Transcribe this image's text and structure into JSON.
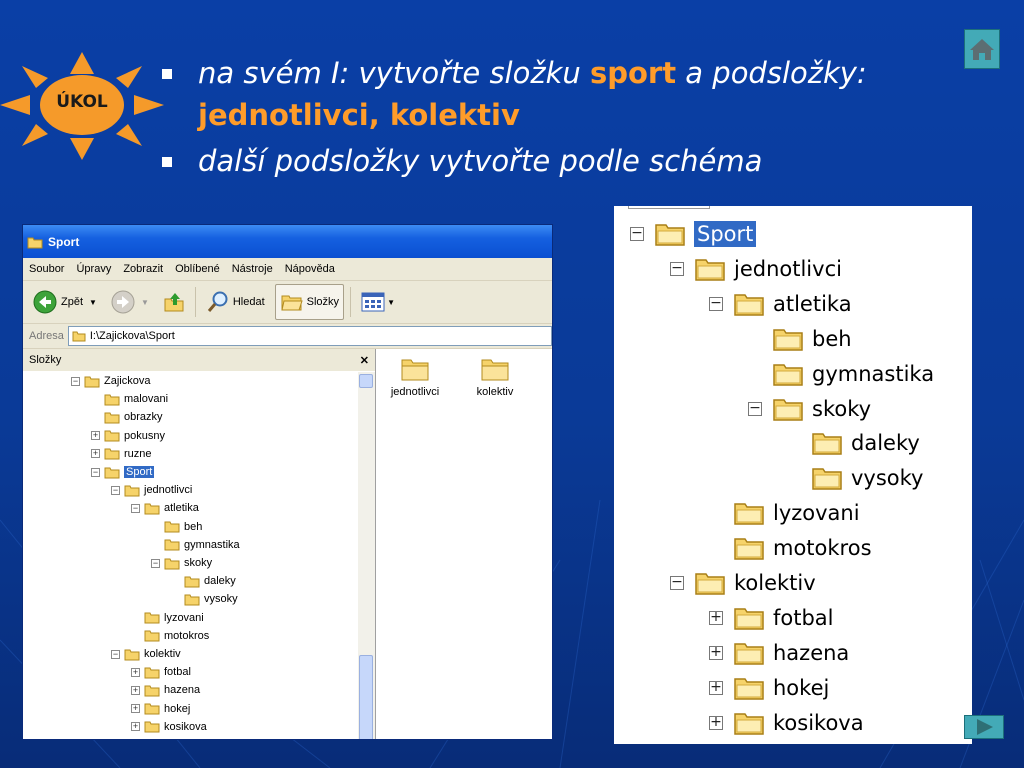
{
  "task": {
    "badge_label": "ÚKOL",
    "bullet1_pre": "na svém I: vytvořte složku ",
    "bullet1_hl1": "sport",
    "bullet1_mid": " a podsložky: ",
    "bullet1_hl2": "jednotlivci, kolektiv",
    "bullet2": "další podsložky vytvořte podle schéma"
  },
  "colors": {
    "background": "#0a3fa6",
    "highlight": "#ff9c2a",
    "sun": "#f59a2a",
    "nav_button": "#43aab7"
  },
  "window": {
    "title": "Sport",
    "menu": [
      "Soubor",
      "Úpravy",
      "Zobrazit",
      "Oblíbené",
      "Nástroje",
      "Nápověda"
    ],
    "toolbar": {
      "back": "Zpět",
      "search": "Hledat",
      "folders": "Složky"
    },
    "address_label": "Adresa",
    "address_value": "I:\\Zajickova\\Sport",
    "folders_pane_title": "Složky",
    "close_glyph": "✕",
    "tree": [
      {
        "label": "Zajickova",
        "exp": "−"
      },
      {
        "label": "malovani",
        "exp": ""
      },
      {
        "label": "obrazky",
        "exp": ""
      },
      {
        "label": "pokusny",
        "exp": "+"
      },
      {
        "label": "ruzne",
        "exp": "+"
      },
      {
        "label": "Sport",
        "exp": "−",
        "selected": true
      },
      {
        "label": "jednotlivci",
        "exp": "−"
      },
      {
        "label": "atletika",
        "exp": "−"
      },
      {
        "label": "beh",
        "exp": ""
      },
      {
        "label": "gymnastika",
        "exp": ""
      },
      {
        "label": "skoky",
        "exp": "−"
      },
      {
        "label": "daleky",
        "exp": ""
      },
      {
        "label": "vysoky",
        "exp": ""
      },
      {
        "label": "lyzovani",
        "exp": ""
      },
      {
        "label": "motokros",
        "exp": ""
      },
      {
        "label": "kolektiv",
        "exp": "−"
      },
      {
        "label": "fotbal",
        "exp": "+"
      },
      {
        "label": "hazena",
        "exp": "+"
      },
      {
        "label": "hokej",
        "exp": "+"
      },
      {
        "label": "kosikova",
        "exp": "+"
      }
    ],
    "content_items": [
      "jednotlivci",
      "kolektiv"
    ]
  },
  "schema": {
    "items": [
      {
        "label": "Sport",
        "exp": "−",
        "selected": true
      },
      {
        "label": "jednotlivci",
        "exp": "−"
      },
      {
        "label": "atletika",
        "exp": "−"
      },
      {
        "label": "beh",
        "exp": ""
      },
      {
        "label": "gymnastika",
        "exp": ""
      },
      {
        "label": "skoky",
        "exp": "−"
      },
      {
        "label": "daleky",
        "exp": ""
      },
      {
        "label": "vysoky",
        "exp": ""
      },
      {
        "label": "lyzovani",
        "exp": ""
      },
      {
        "label": "motokros",
        "exp": ""
      },
      {
        "label": "kolektiv",
        "exp": "−"
      },
      {
        "label": "fotbal",
        "exp": "+"
      },
      {
        "label": "hazena",
        "exp": "+"
      },
      {
        "label": "hokej",
        "exp": "+"
      },
      {
        "label": "kosikova",
        "exp": "+"
      }
    ]
  }
}
